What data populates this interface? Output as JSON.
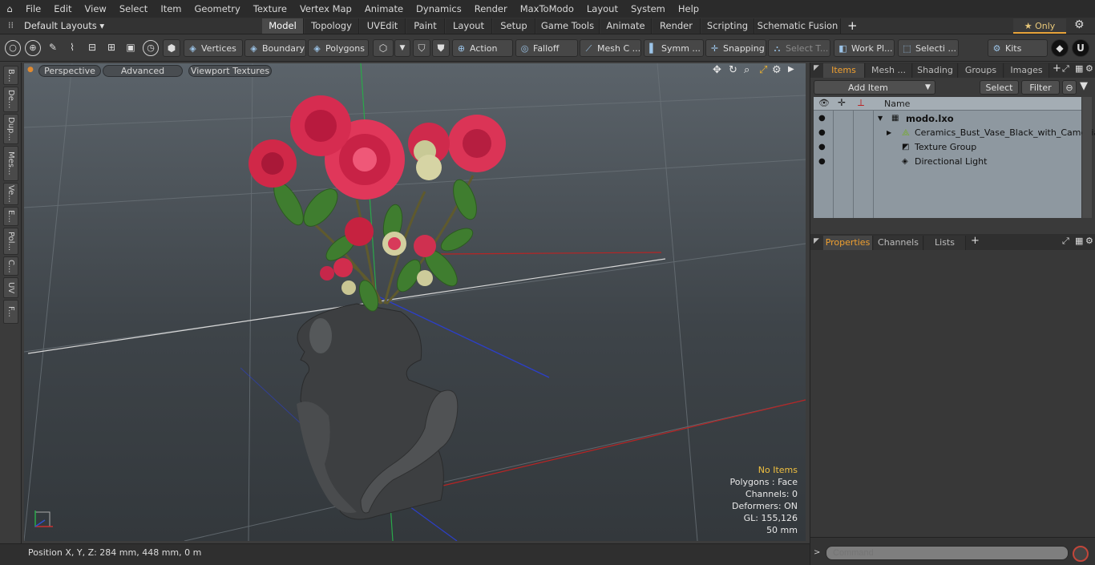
{
  "menu": [
    "File",
    "Edit",
    "View",
    "Select",
    "Item",
    "Geometry",
    "Texture",
    "Vertex Map",
    "Animate",
    "Dynamics",
    "Render",
    "MaxToModo",
    "Layout",
    "System",
    "Help"
  ],
  "layouts_label": "Default Layouts ▾",
  "tabs": [
    "Model",
    "Topology",
    "UVEdit",
    "Paint",
    "Layout",
    "Setup",
    "Game Tools",
    "Animate",
    "Render",
    "Scripting",
    "Schematic Fusion"
  ],
  "active_tab": "Model",
  "only_label": "★  Only",
  "toolbar": {
    "vertices": "Vertices",
    "boundary": "Boundary",
    "polygons": "Polygons",
    "action": "Action",
    "falloff": "Falloff",
    "mesh": "Mesh C ...",
    "symm": "Symm ...",
    "snapping": "Snapping",
    "select_t": "Select T...",
    "work_pl": "Work Pl...",
    "selecti": "Selecti ...",
    "kits": "Kits"
  },
  "left_tabs": [
    "B...",
    "De...",
    "Dup...",
    "Mes...",
    "Ve...",
    "E...",
    "Pol...",
    "C...",
    "UV",
    "F..."
  ],
  "viewport": {
    "perspective": "Perspective",
    "advanced": "Advanced",
    "textures": "Viewport Textures",
    "hud": {
      "no_items": "No Items",
      "polygons": "Polygons : Face",
      "channels": "Channels: 0",
      "deformers": "Deformers: ON",
      "gl": "GL: 155,126",
      "mm": "50 mm"
    }
  },
  "status": "Position X, Y, Z:   284 mm, 448 mm, 0 m",
  "items_panel": {
    "tabs": [
      "Items",
      "Mesh ...",
      "Shading",
      "Groups",
      "Images"
    ],
    "add_item": "Add Item",
    "select": "Select",
    "filter": "Filter",
    "name_col": "Name",
    "rows": [
      "modo.lxo",
      "Ceramics_Bust_Vase_Black_with_Camellia",
      "Texture Group",
      "Directional Light"
    ]
  },
  "props_panel": {
    "tabs": [
      "Properties",
      "Channels",
      "Lists"
    ]
  },
  "command_placeholder": "Command"
}
